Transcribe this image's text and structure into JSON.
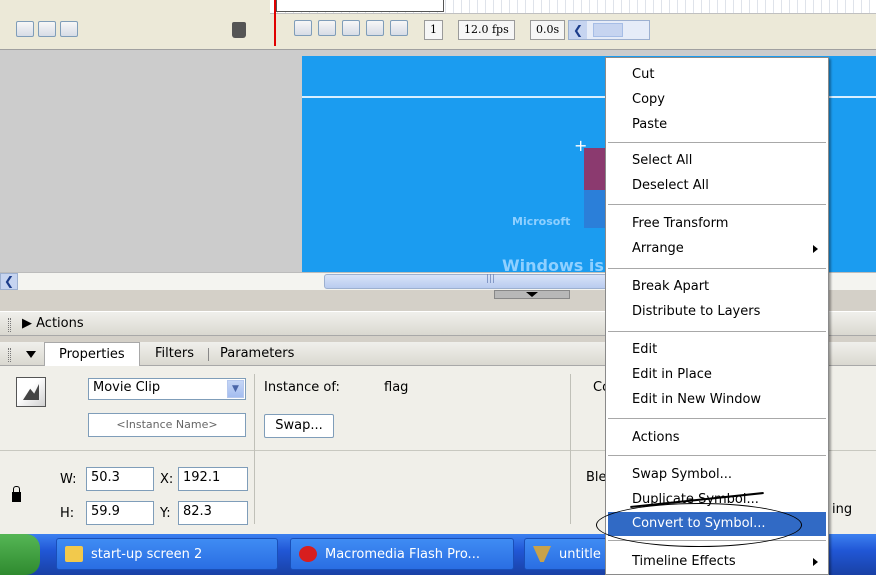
{
  "timeline": {
    "frame_number": "1",
    "fps": "12.0 fps",
    "elapsed": "0.0s"
  },
  "stage": {
    "microsoft_text": "Microsoft",
    "windows_text": "Windows is"
  },
  "panels": {
    "actions_label": "Actions",
    "tabs": [
      "Properties",
      "Filters",
      "Parameters"
    ]
  },
  "properties": {
    "symbol_type": "Movie Clip",
    "instance_name_placeholder": "<Instance Name>",
    "instance_of_label": "Instance of:",
    "instance_of_value": "flag",
    "swap_label": "Swap...",
    "color_label_partial": "Co",
    "blend_label_partial": "Ble",
    "caching_label_partial": "ing",
    "w_label": "W:",
    "w_value": "50.3",
    "h_label": "H:",
    "h_value": "59.9",
    "x_label": "X:",
    "x_value": "192.1",
    "y_label": "Y:",
    "y_value": "82.3"
  },
  "context_menu": {
    "cut": "Cut",
    "copy": "Copy",
    "paste": "Paste",
    "select_all": "Select All",
    "deselect_all": "Deselect All",
    "free_transform": "Free Transform",
    "arrange": "Arrange",
    "break_apart": "Break Apart",
    "distribute": "Distribute to Layers",
    "edit": "Edit",
    "edit_in_place": "Edit in Place",
    "edit_new_window": "Edit in New Window",
    "actions": "Actions",
    "swap_symbol": "Swap Symbol...",
    "duplicate_symbol": "Duplicate Symbol...",
    "convert_to_symbol": "Convert to Symbol...",
    "timeline_effects": "Timeline Effects"
  },
  "taskbar": {
    "task1": "start-up screen 2",
    "task2": "Macromedia Flash Pro...",
    "task3": "untitle"
  },
  "colors": {
    "stage_blue": "#1b9cf0",
    "menu_highlight": "#316ac5",
    "taskbar_blue": "#2157d6"
  }
}
